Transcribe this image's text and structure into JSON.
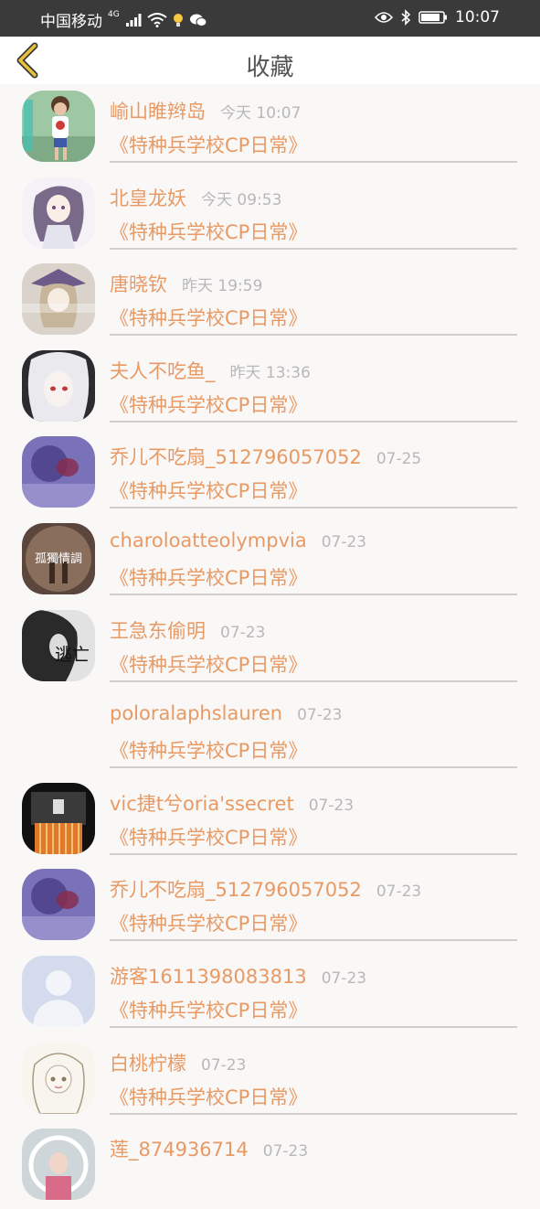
{
  "status_bar": {
    "carrier": "中国移动",
    "network": "4G",
    "time": "10:07"
  },
  "header": {
    "title": "收藏"
  },
  "colors": {
    "accent": "#e89a64",
    "muted": "#b8b8b8",
    "divider": "#cfcfcf"
  },
  "favorites": [
    {
      "name": "崳山睢辫岛",
      "time": "今天 10:07",
      "work": "《特种兵学校CP日常》"
    },
    {
      "name": "北皇龙妖",
      "time": "今天 09:53",
      "work": "《特种兵学校CP日常》"
    },
    {
      "name": "唐晓钦",
      "time": "昨天 19:59",
      "work": "《特种兵学校CP日常》"
    },
    {
      "name": "夫人不吃鱼_",
      "time": "昨天 13:36",
      "work": "《特种兵学校CP日常》"
    },
    {
      "name": "乔儿不吃扇_512796057052",
      "time": "07-25",
      "work": "《特种兵学校CP日常》"
    },
    {
      "name": "charoloatteolympvia",
      "time": "07-23",
      "work": "《特种兵学校CP日常》",
      "avatar_text": "孤獨情調"
    },
    {
      "name": "王急东偷明",
      "time": "07-23",
      "work": "《特种兵学校CP日常》",
      "avatar_text": "逃亡"
    },
    {
      "name": "poloralaphslauren",
      "time": "07-23",
      "work": "《特种兵学校CP日常》"
    },
    {
      "name": "vic捷t兮oria'ssecret",
      "time": "07-23",
      "work": "《特种兵学校CP日常》"
    },
    {
      "name": "乔儿不吃扇_512796057052",
      "time": "07-23",
      "work": "《特种兵学校CP日常》"
    },
    {
      "name": "游客1611398083813",
      "time": "07-23",
      "work": "《特种兵学校CP日常》"
    },
    {
      "name": "白桃柠檬",
      "time": "07-23",
      "work": "《特种兵学校CP日常》"
    },
    {
      "name": "莲_874936714",
      "time": "07-23",
      "work": ""
    }
  ]
}
